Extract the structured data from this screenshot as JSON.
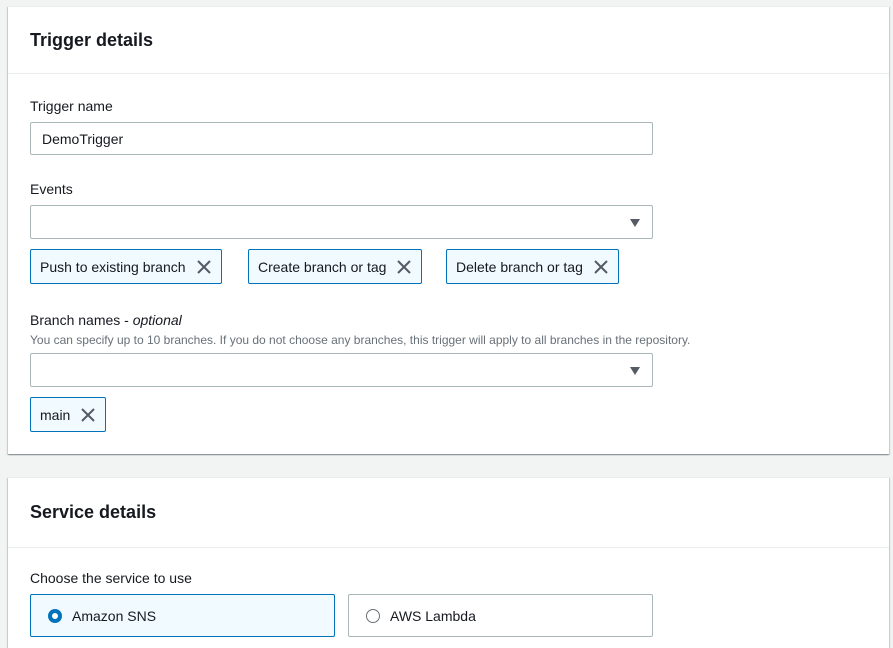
{
  "trigger_details": {
    "title": "Trigger details",
    "trigger_name": {
      "label": "Trigger name",
      "value": "DemoTrigger"
    },
    "events": {
      "label": "Events",
      "selected_tokens": [
        "Push to existing branch",
        "Create branch or tag",
        "Delete branch or tag"
      ]
    },
    "branch_names": {
      "label": "Branch names - ",
      "label_optional": "optional",
      "description": "You can specify up to 10 branches. If you do not choose any branches, this trigger will apply to all branches in the repository.",
      "selected_tokens": [
        "main"
      ]
    }
  },
  "service_details": {
    "title": "Service details",
    "choose_label": "Choose the service to use",
    "options": [
      {
        "label": "Amazon SNS",
        "selected": true
      },
      {
        "label": "AWS Lambda",
        "selected": false
      }
    ]
  },
  "colors": {
    "accent": "#0073bb",
    "token_bg": "#f1faff",
    "border": "#aab7b8"
  },
  "icons": {
    "token_remove": "close-icon",
    "dropdown": "caret-down-icon"
  }
}
